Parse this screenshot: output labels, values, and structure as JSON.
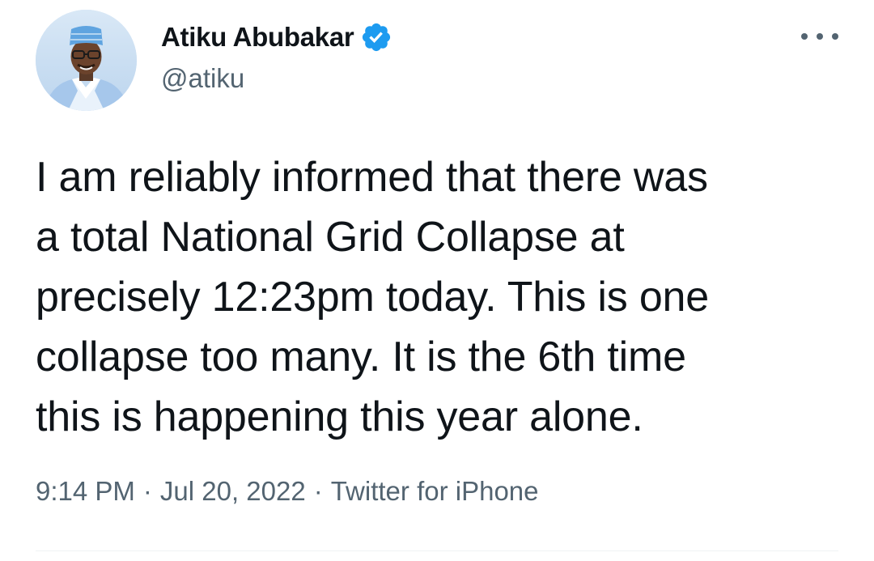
{
  "author": {
    "display_name": "Atiku Abubakar",
    "handle": "@atiku",
    "verified_icon": "verified-badge-icon",
    "avatar": "profile-avatar"
  },
  "tweet": {
    "text": "I am reliably informed that there was\na total National Grid Collapse at\nprecisely 12:23pm today. This is one\ncollapse too many. It is the 6th time\nthis is happening this year alone."
  },
  "meta": {
    "time": "9:14 PM",
    "separator": "·",
    "date": "Jul 20, 2022",
    "source": "Twitter for iPhone"
  },
  "menu": {
    "icon": "more-options-icon"
  },
  "colors": {
    "text_primary": "#0f1419",
    "text_secondary": "#536471",
    "verified_blue": "#1d9bf0",
    "divider": "#eff3f4"
  }
}
